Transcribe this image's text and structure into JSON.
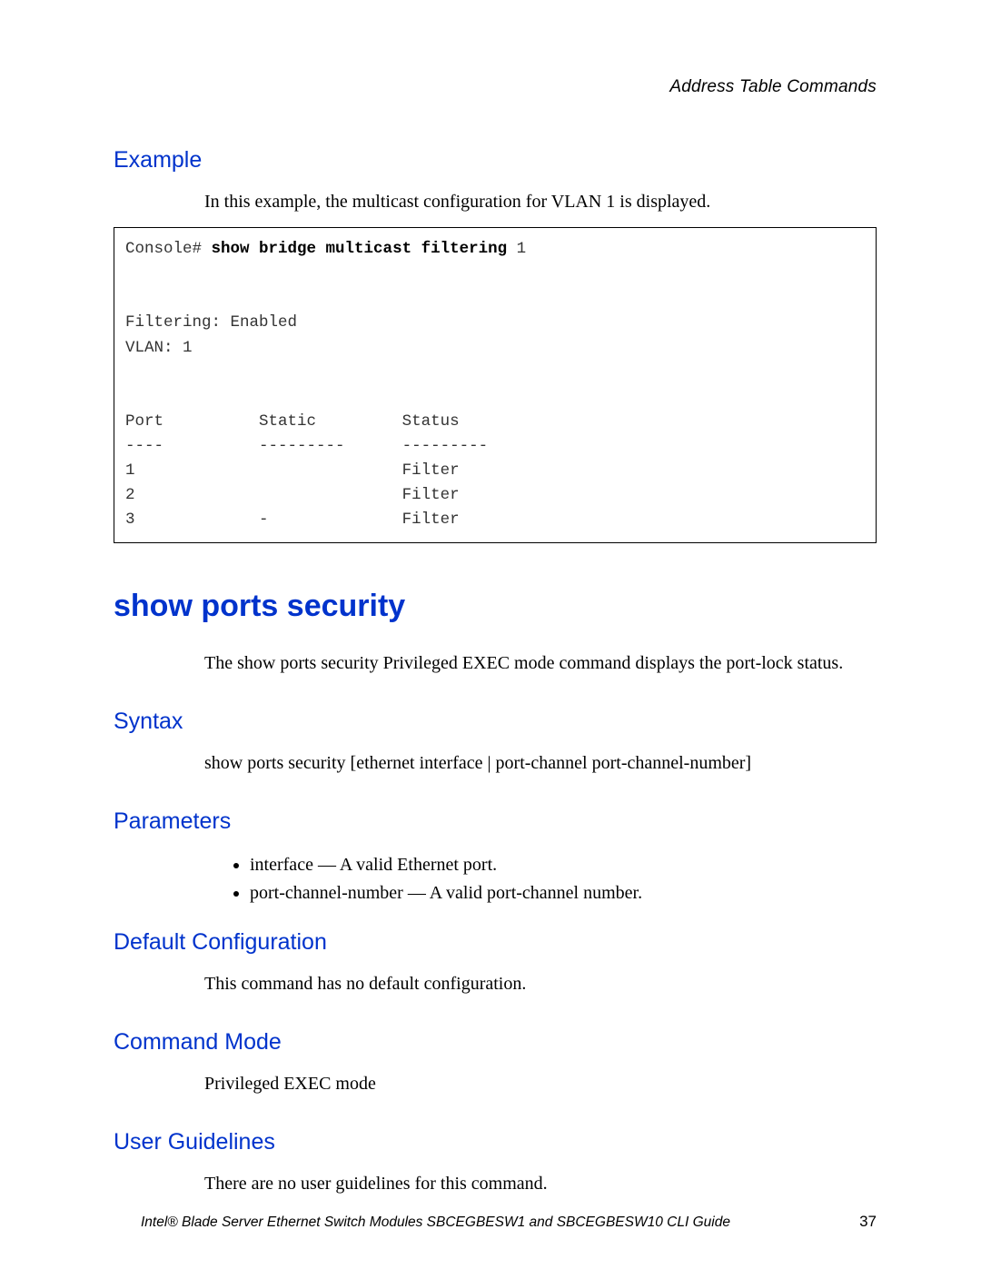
{
  "running_header": "Address Table Commands",
  "example": {
    "heading": "Example",
    "intro": "In this example, the multicast configuration for VLAN 1 is displayed.",
    "console": {
      "prompt": "Console#",
      "command": "show bridge multicast filtering",
      "arg": "1",
      "filtering_line": "Filtering: Enabled",
      "vlan_line": "VLAN: 1",
      "header_port": "Port",
      "header_static": "Static",
      "header_status": "Status",
      "sep_port": "----",
      "sep_static": "---------",
      "sep_status": "---------",
      "rows": [
        {
          "port": "1",
          "static": "",
          "status": "Filter"
        },
        {
          "port": "2",
          "static": "",
          "status": "Filter"
        },
        {
          "port": "3",
          "static": "-",
          "status": "Filter"
        }
      ]
    }
  },
  "command": {
    "title": "show ports security",
    "description": "The show ports security Privileged EXEC mode command displays the port-lock status.",
    "syntax_heading": "Syntax",
    "syntax_text": "show ports security [ethernet interface | port-channel port-channel-number]",
    "parameters_heading": "Parameters",
    "parameters": [
      "interface — A valid Ethernet port.",
      "port-channel-number — A valid port-channel number."
    ],
    "default_heading": "Default Configuration",
    "default_text": "This command has no default configuration.",
    "mode_heading": "Command Mode",
    "mode_text": "Privileged EXEC mode",
    "guidelines_heading": "User Guidelines",
    "guidelines_text": "There are no user guidelines for this command."
  },
  "footer": {
    "title": "Intel® Blade Server Ethernet Switch Modules SBCEGBESW1 and SBCEGBESW10 CLI Guide",
    "page": "37"
  }
}
